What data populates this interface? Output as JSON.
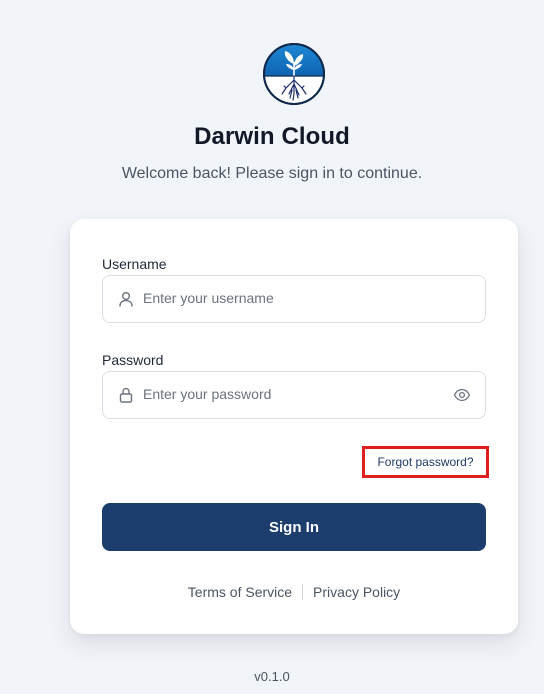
{
  "app": {
    "title": "Darwin Cloud",
    "subtitle": "Welcome back! Please sign in to continue."
  },
  "form": {
    "username": {
      "label": "Username",
      "placeholder": "Enter your username",
      "value": "",
      "icon": "user-icon"
    },
    "password": {
      "label": "Password",
      "placeholder": "Enter your password",
      "value": "",
      "icon": "lock-icon",
      "toggle_icon": "eye-icon"
    },
    "forgot_password": "Forgot password?",
    "sign_in_label": "Sign In"
  },
  "footer": {
    "terms": "Terms of Service",
    "privacy": "Privacy Policy",
    "version": "v0.1.0"
  },
  "colors": {
    "background": "#f1f4f8",
    "primary": "#1b3e6e",
    "link": "#1e3a6a",
    "highlight_border": "#e01e1e",
    "logo_blue": "#1478c8"
  }
}
